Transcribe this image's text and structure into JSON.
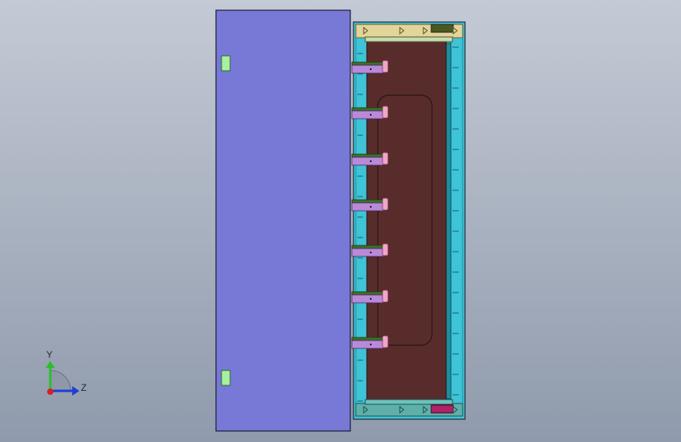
{
  "viewport": {
    "background_top": "#c4cad5",
    "background_bottom": "#8f9aac"
  },
  "colors": {
    "door": "#7878d6",
    "door_outline": "#1a1a3a",
    "handle": "#a6f0a0",
    "frame": "#3fc3d6",
    "frame_dark": "#1d8fa0",
    "back_panel": "#592c2c",
    "top_rail": "#e3d49a",
    "bottom_rail": "#5fb0aa",
    "top_block": "#4a5a1e",
    "bottom_block": "#b0226a",
    "shelf_bracket": "#b88ad8",
    "shelf_top": "#3f6f2a",
    "shelf_clip": "#f0a6c6"
  },
  "shelves": {
    "count": 7
  },
  "triad": {
    "y_label": "Y",
    "z_label": "Z",
    "y_color": "#2bbf2b",
    "z_color": "#1a3fd6",
    "x_color": "#d62020"
  }
}
